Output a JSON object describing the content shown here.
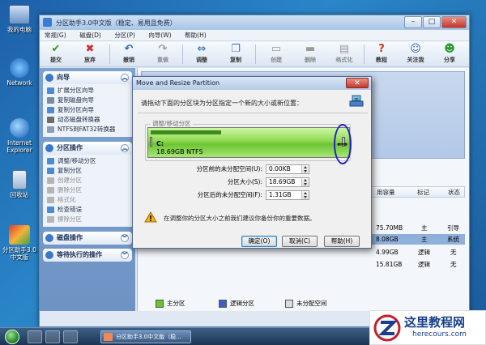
{
  "desktop": {
    "icons": [
      {
        "label": "我的电脑",
        "icon": "computer-icon"
      },
      {
        "label": "Network",
        "icon": "network-icon"
      },
      {
        "label": "Internet Explorer",
        "icon": "ie-icon"
      },
      {
        "label": "回收站",
        "icon": "recycle-bin-icon"
      },
      {
        "label": "分区助手3.0中文版",
        "icon": "partition-assistant-icon"
      }
    ]
  },
  "taskbar": {
    "app_label": "分区助手3.0中文版（稳..."
  },
  "app": {
    "title": "分区助手3.0中文版（稳定、易用且免费）",
    "menu": [
      "常规(G)",
      "磁盘(D)",
      "分区(P)",
      "向导(W)",
      "帮助(H)"
    ],
    "toolbar": [
      {
        "label": "提交",
        "icon": "check-icon",
        "enabled": true
      },
      {
        "label": "放弃",
        "icon": "x-icon",
        "enabled": true
      },
      {
        "label": "撤销",
        "icon": "undo-icon",
        "enabled": true
      },
      {
        "label": "重做",
        "icon": "redo-icon",
        "enabled": false
      },
      {
        "label": "调整",
        "icon": "resize-icon",
        "enabled": true
      },
      {
        "label": "复制",
        "icon": "copy-icon",
        "enabled": true
      },
      {
        "label": "创建",
        "icon": "create-icon",
        "enabled": false
      },
      {
        "label": "删除",
        "icon": "delete-icon",
        "enabled": false
      },
      {
        "label": "格式化",
        "icon": "format-icon",
        "enabled": false
      },
      {
        "label": "教程",
        "icon": "tutorial-icon",
        "enabled": true
      },
      {
        "label": "关注我",
        "icon": "follow-icon",
        "enabled": true
      },
      {
        "label": "分享",
        "icon": "share-icon",
        "enabled": true
      }
    ],
    "sidebar": {
      "wizard": {
        "title": "向导",
        "items": [
          "扩展分区向导",
          "复制磁盘向导",
          "复制分区向导",
          "动态磁盘转换器",
          "NTFS到FAT32转换器"
        ]
      },
      "partition_ops": {
        "title": "分区操作",
        "items": [
          {
            "label": "调整/移动分区",
            "enabled": true
          },
          {
            "label": "复制分区",
            "enabled": true
          },
          {
            "label": "创建分区",
            "enabled": false
          },
          {
            "label": "删除分区",
            "enabled": false
          },
          {
            "label": "格式化",
            "enabled": false
          },
          {
            "label": "检查错误",
            "enabled": true
          },
          {
            "label": "擦除分区",
            "enabled": false
          }
        ]
      },
      "disk_ops": {
        "title": "磁盘操作"
      },
      "pending_ops": {
        "title": "等待执行的操作"
      }
    },
    "table": {
      "headers": [
        "用容量",
        "标记",
        "状态"
      ],
      "rows": [
        [
          "75.70MB",
          "主",
          "引导"
        ],
        [
          "8.08GB",
          "主",
          "系统"
        ],
        [
          "4.99GB",
          "逻辑",
          "无"
        ],
        [
          "15.81GB",
          "逻辑",
          "无"
        ]
      ]
    },
    "legend": [
      "主分区",
      "逻辑分区",
      "未分配空间"
    ]
  },
  "dialog": {
    "title": "Move and Resize Partition",
    "close_label": "✕",
    "description": "请拖动下面的分区块为分区指定一个新的大小或新位置：",
    "group_label": "调整/移动分区",
    "partition": {
      "name": "C:",
      "info": "18.69GB NTFS",
      "used_fraction": 0.36
    },
    "fields": [
      {
        "label": "分区前的未分配空间(U):",
        "value": "0.00KB"
      },
      {
        "label": "分区大小(S):",
        "value": "18.69GB"
      },
      {
        "label": "分区后的未分配空间(F):",
        "value": "1.31GB"
      }
    ],
    "warning": "在调整你的分区大小之前我们建议你备份你的重要数据。",
    "buttons": {
      "ok": "确定(O)",
      "cancel": "取消(C)",
      "help": "帮助(H)"
    }
  },
  "watermark": {
    "cn": "这里教程网",
    "en": "herecours.com"
  }
}
